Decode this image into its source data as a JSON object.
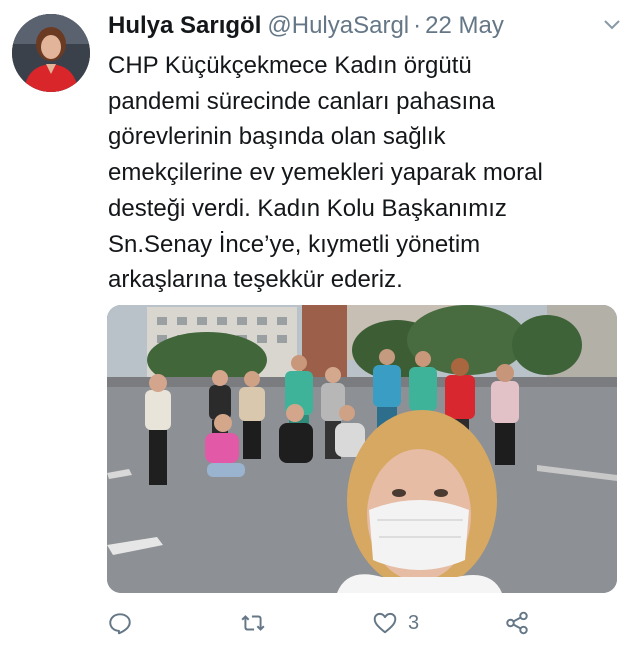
{
  "tweet": {
    "display_name": "Hulya Sarıgöl",
    "handle": "@HulyaSargl",
    "separator": "·",
    "date": "22 May",
    "text": "CHP Küçükçekmece Kadın örgütü\npandemi sürecinde canları pahasına\ngörevlerinin başında olan sağlık\nemekçilerine ev yemekleri yaparak moral\ndesteği verdi. Kadın Kolu Başkanımız\nSn.Senay İnce’ye, kıymetli yönetim\narkaşlarına teşekkür ederiz.",
    "media_description": "Group photo of masked women standing in a parking lot with a selfie in the foreground"
  },
  "actions": {
    "reply_count": "",
    "retweet_count": "",
    "like_count": "3",
    "share_label": ""
  },
  "colors": {
    "text": "#14171a",
    "secondary": "#657786",
    "background": "#ffffff"
  },
  "icons": [
    "reply-icon",
    "retweet-icon",
    "like-icon",
    "share-icon",
    "chevron-down-icon"
  ]
}
